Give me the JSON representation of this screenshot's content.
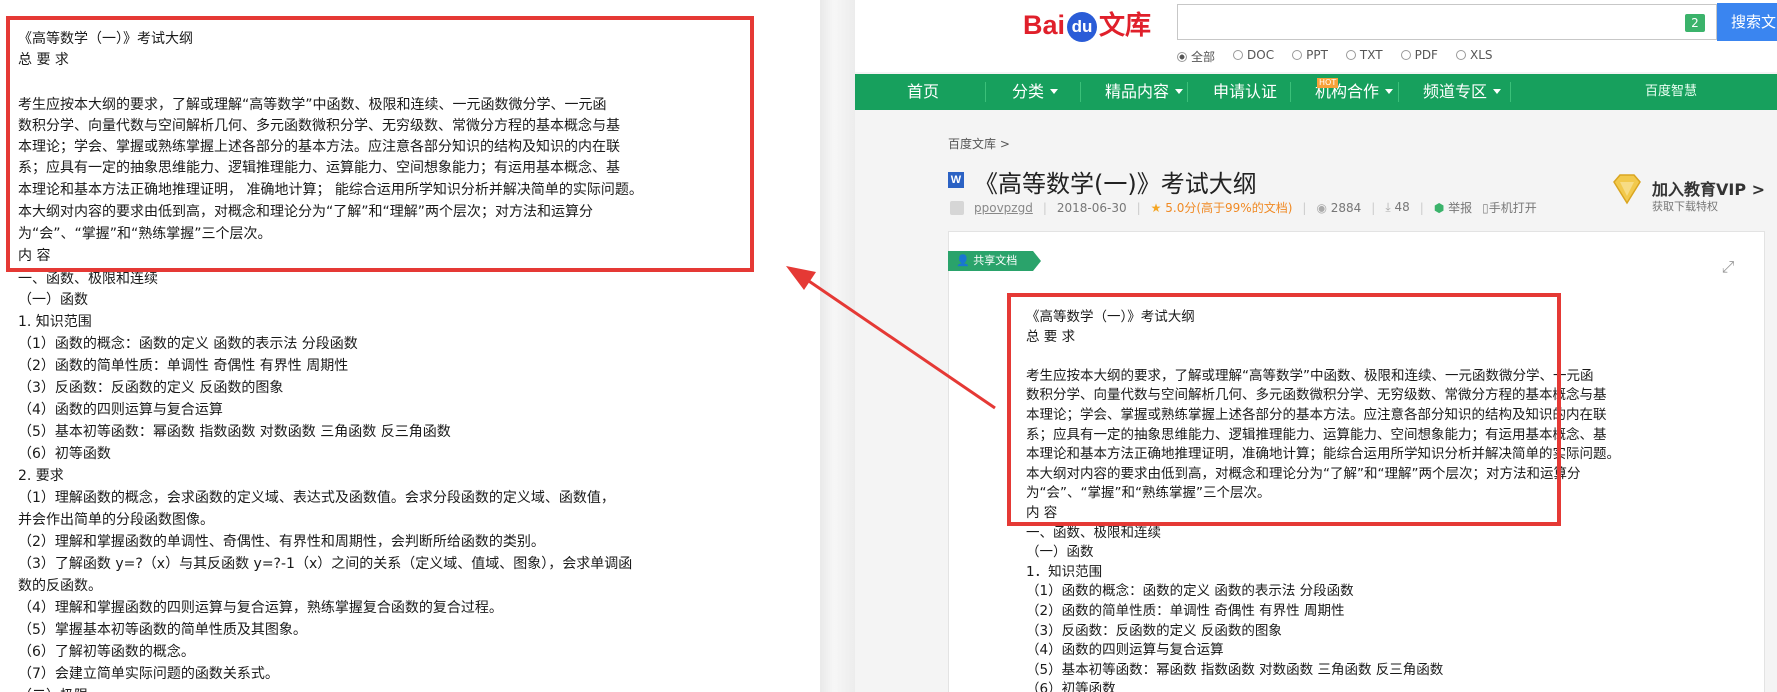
{
  "left_doc": {
    "lines": [
      "《高等数学（一）》考试大纲",
      "总 要 求",
      "",
      "考生应按本大纲的要求，了解或理解“高等数学”中函数、极限和连续、一元函数微分学、一元函",
      "数积分学、向量代数与空间解析几何、多元函数微积分学、无穷级数、常微分方程的基本概念与基",
      "本理论；学会、掌握或熟练掌握上述各部分的基本方法。应注意各部分知识的结构及知识的内在联",
      "系；应具有一定的抽象思维能力、逻辑推理能力、运算能力、空间想象能力；有运用基本概念、基",
      "本理论和基本方法正确地推理证明，  准确地计算；  能综合运用所学知识分析并解决简单的实际问题。",
      "本大纲对内容的要求由低到高，对概念和理论分为“了解”和“理解”两个层次；对方法和运算分",
      "为“会”、“掌握”和“熟练掌握”三个层次。",
      "内  容",
      "一、函数、极限和连续",
      "（一）函数",
      "1.  知识范围",
      "（1）函数的概念：函数的定义    函数的表示法    分段函数",
      "（2）函数的简单性质：单调性    奇偶性  有界性  周期性",
      "（3）反函数：反函数的定义    反函数的图象",
      "（4）函数的四则运算与复合运算",
      "（5）基本初等函数：幂函数    指数函数   对数函数   三角函数   反三角函数",
      "（6）初等函数",
      "2.  要求",
      "（1）理解函数的概念，会求函数的定义域、表达式及函数值。会求分段函数的定义域、函数值，",
      "并会作出简单的分段函数图像。",
      "（2）理解和掌握函数的单调性、奇偶性、有界性和周期性，会判断所给函数的类别。",
      "（3）了解函数  y=?（x）与其反函数   y=?-1（x）之间的关系（定义域、值域、图象），会求单调函",
      "数的反函数。",
      "（4）理解和掌握函数的四则运算与复合运算，熟练掌握复合函数的复合过程。",
      "（5）掌握基本初等函数的简单性质及其图象。",
      "（6）了解初等函数的概念。",
      "（7）会建立简单实际问题的函数关系式。",
      "（二）极限"
    ]
  },
  "site": {
    "logo_bai": "Bai",
    "logo_du": "du",
    "logo_wenku": "文库",
    "search_value": "",
    "search_count": "2",
    "search_button": "搜索文",
    "filters": [
      "全部",
      "DOC",
      "PPT",
      "TXT",
      "PDF",
      "XLS"
    ],
    "nav": [
      {
        "label": "首页",
        "dropdown": false
      },
      {
        "label": "分类",
        "dropdown": true
      },
      {
        "label": "精品内容",
        "dropdown": true
      },
      {
        "label": "申请认证",
        "dropdown": false
      },
      {
        "label": "机构合作",
        "dropdown": true
      },
      {
        "label": "频道专区",
        "dropdown": true
      },
      {
        "label": "百度智慧",
        "dropdown": false
      }
    ],
    "hot_badge": "HOT"
  },
  "doc": {
    "breadcrumb": "百度文库 >",
    "icon_letter": "W",
    "title": "《高等数学(一)》考试大纲",
    "author": "ppovpzgd",
    "date": "2018-06-30",
    "rating": "5.0分(高于99%的文档)",
    "views": "2884",
    "downloads": "48",
    "report": "举报",
    "phone_open": "手机打开",
    "vip_title": "加入教育VIP >",
    "vip_sub": "获取下载特权",
    "share_badge": "共享文档"
  },
  "right_doc": {
    "lines": [
      "《高等数学（一）》考试大纲",
      "总 要 求",
      "",
      "考生应按本大纲的要求，了解或理解“高等数学”中函数、极限和连续、一元函数微分学、一元函",
      "数积分学、向量代数与空间解析几何、多元函数微积分学、无穷级数、常微分方程的基本概念与基",
      "本理论；学会、掌握或熟练掌握上述各部分的基本方法。应注意各部分知识的结构及知识的内在联",
      "系；应具有一定的抽象思维能力、逻辑推理能力、运算能力、空间想象能力；有运用基本概念、基",
      "本理论和基本方法正确地推理证明，准确地计算；能综合运用所学知识分析并解决简单的实际问题。",
      "本大纲对内容的要求由低到高，对概念和理论分为“了解”和“理解”两个层次；对方法和运算分",
      "为“会”、“掌握”和“熟练掌握”三个层次。",
      "内 容",
      "一、函数、极限和连续",
      "（一）函数",
      "1．知识范围",
      "（1）函数的概念：函数的定义 函数的表示法 分段函数",
      "（2）函数的简单性质：单调性 奇偶性 有界性 周期性",
      "（3）反函数：反函数的定义 反函数的图象",
      "（4）函数的四则运算与复合运算",
      "（5）基本初等函数：幂函数 指数函数 对数函数 三角函数 反三角函数",
      "（6）初等函数"
    ]
  },
  "colors": {
    "highlight": "#e53935",
    "nav_green": "#17a05d",
    "baidu_red": "#e0202b",
    "baidu_blue": "#2a5cd7",
    "search_blue": "#3a85f0"
  }
}
